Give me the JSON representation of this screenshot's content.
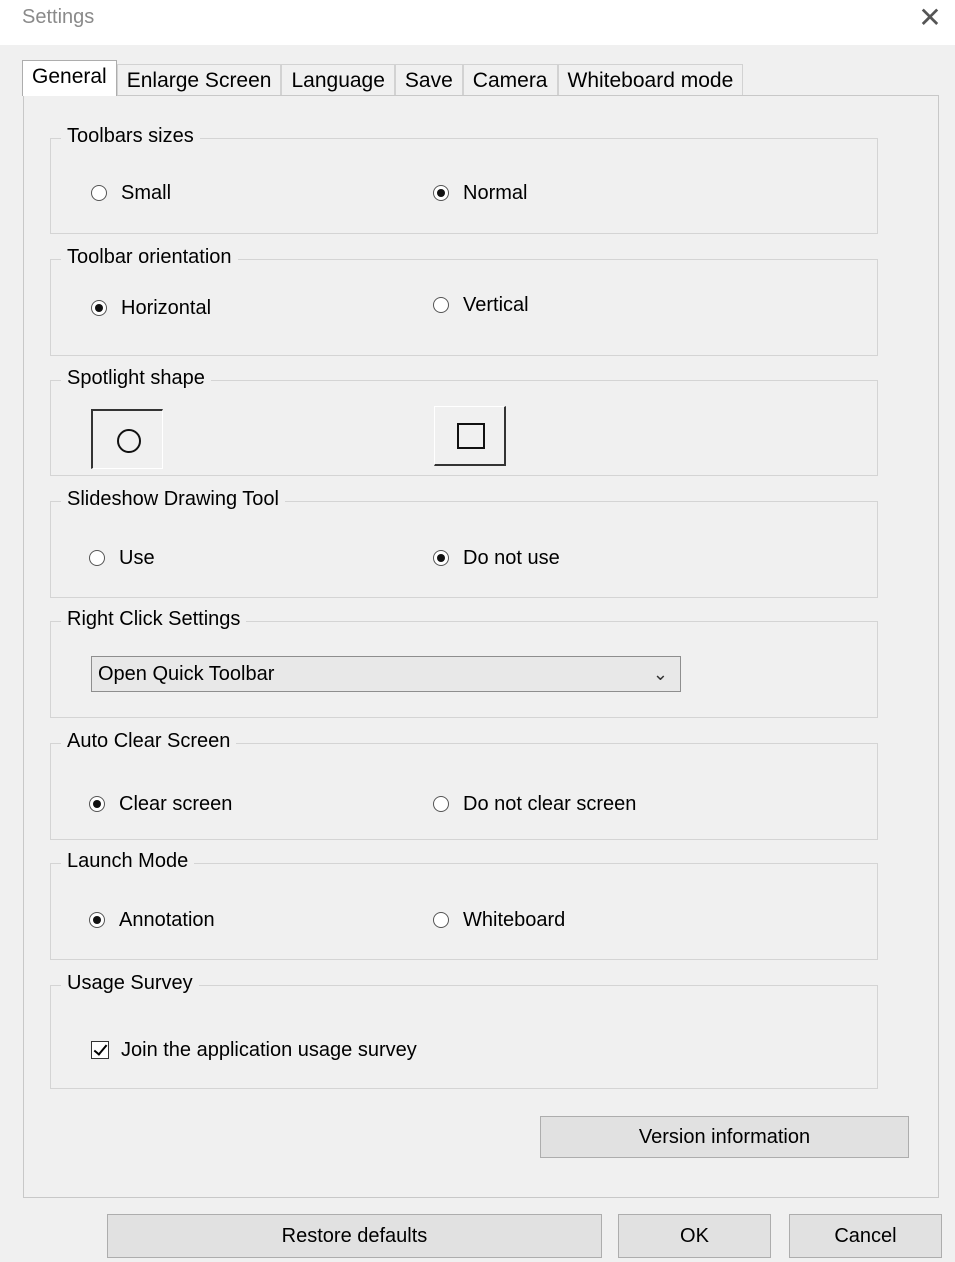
{
  "window": {
    "title": "Settings",
    "close_icon": "close-icon"
  },
  "tabs": [
    "General",
    "Enlarge Screen",
    "Language",
    "Save",
    "Camera",
    "Whiteboard mode"
  ],
  "active_tab": "General",
  "groups": {
    "toolbar_sizes": {
      "legend": "Toolbars sizes",
      "opt1": "Small",
      "opt2": "Normal",
      "selected": "Normal"
    },
    "toolbar_orientation": {
      "legend": "Toolbar orientation",
      "opt1": "Horizontal",
      "opt2": "Vertical",
      "selected": "Horizontal"
    },
    "spotlight_shape": {
      "legend": "Spotlight shape",
      "opt1_icon": "circle-icon",
      "opt2_icon": "square-icon",
      "selected": "circle"
    },
    "slideshow_tool": {
      "legend": "Slideshow Drawing Tool",
      "opt1": "Use",
      "opt2": "Do not use",
      "selected": "Do not use"
    },
    "right_click": {
      "legend": "Right Click Settings",
      "value": "Open Quick Toolbar"
    },
    "auto_clear": {
      "legend": "Auto Clear Screen",
      "opt1": "Clear screen",
      "opt2": "Do not clear screen",
      "selected": "Clear screen"
    },
    "launch_mode": {
      "legend": "Launch Mode",
      "opt1": "Annotation",
      "opt2": "Whiteboard",
      "selected": "Annotation"
    },
    "usage_survey": {
      "legend": "Usage Survey",
      "checkbox": "Join the application usage survey",
      "checked": true
    }
  },
  "buttons": {
    "version": "Version information",
    "restore": "Restore defaults",
    "ok": "OK",
    "cancel": "Cancel"
  }
}
